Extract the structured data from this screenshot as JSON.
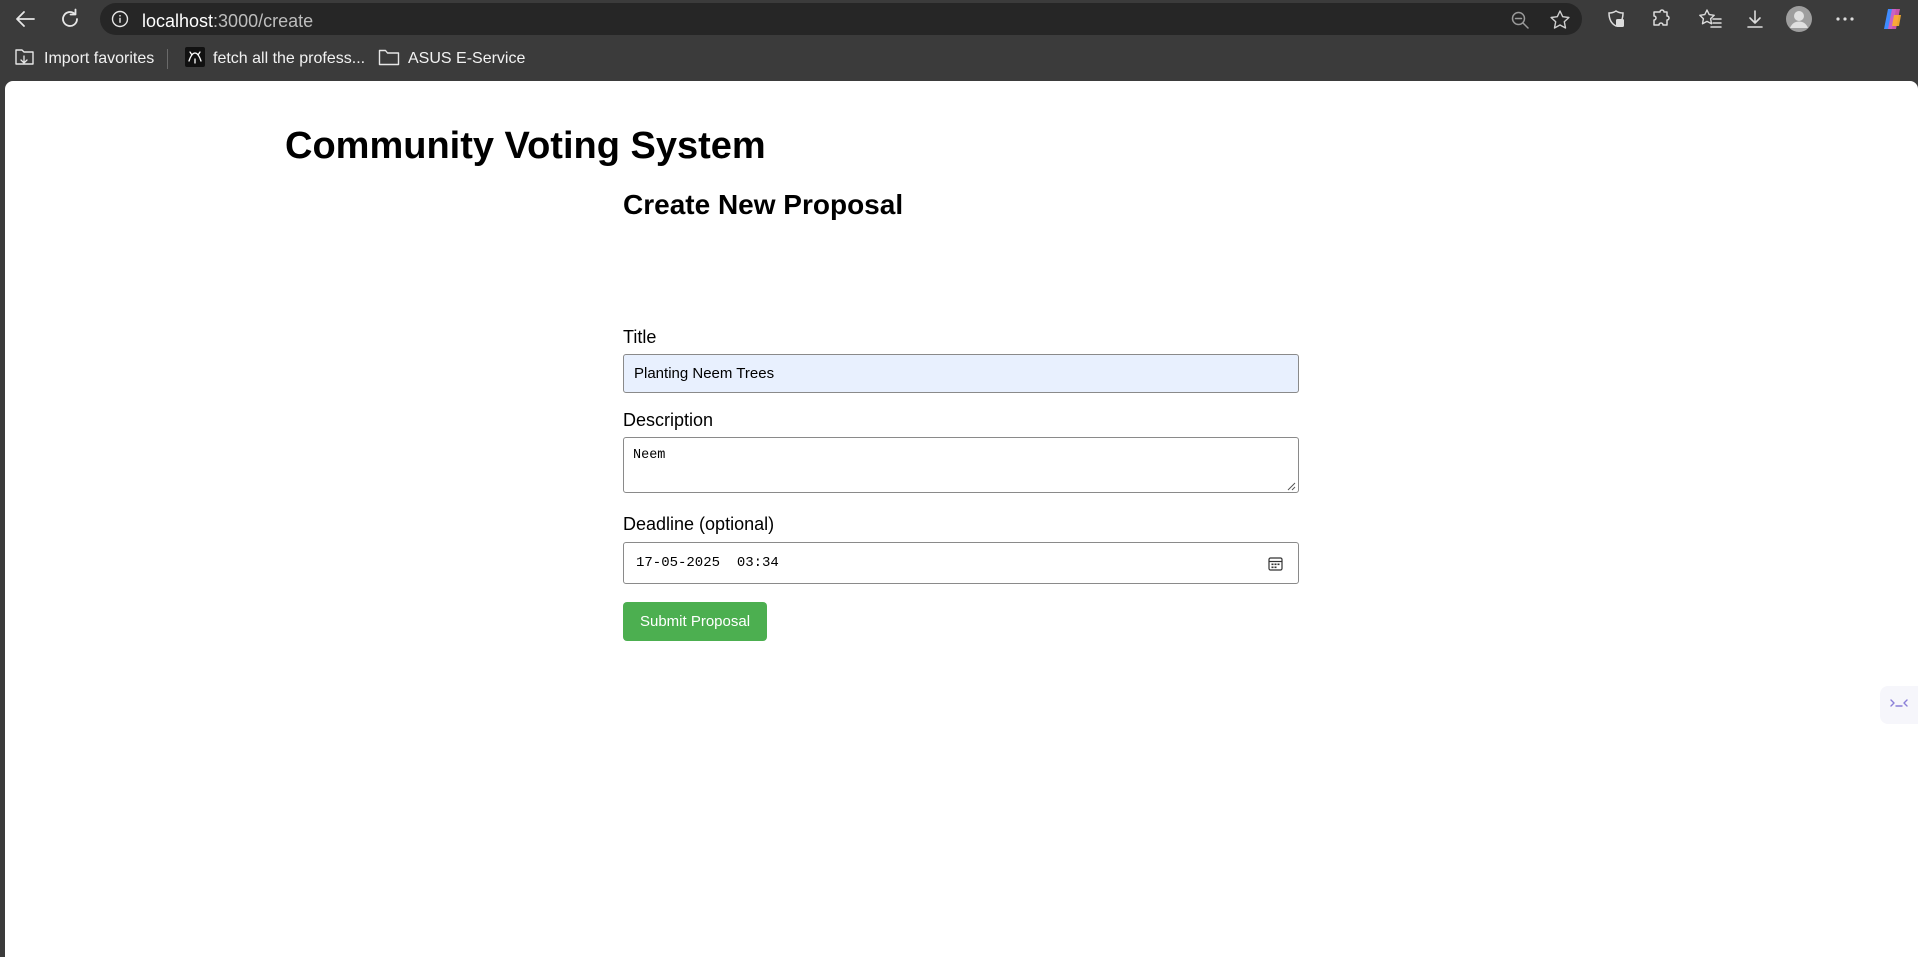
{
  "browser": {
    "url_host": "localhost",
    "url_path": ":3000/create",
    "icons": [
      "back-icon",
      "refresh-icon",
      "site-info-icon",
      "zoom-out-icon",
      "favorite-star-icon",
      "browser-essentials-icon",
      "extensions-icon",
      "favorites-icon",
      "downloads-icon",
      "profile-icon",
      "more-icon",
      "copilot-icon"
    ]
  },
  "favorites_bar": {
    "items": [
      {
        "label": "Import favorites",
        "icon": "import-icon"
      },
      {
        "label": "fetch all the profess...",
        "icon": "site-favicon"
      },
      {
        "label": "ASUS E-Service",
        "icon": "folder-icon"
      }
    ]
  },
  "page": {
    "app_title": "Community Voting System",
    "form_title": "Create New Proposal",
    "fields": {
      "title_label": "Title",
      "title_value": "Planting Neem Trees",
      "description_label": "Description",
      "description_value": "Neem",
      "deadline_label": "Deadline (optional)",
      "deadline_value": "17-05-2025  03:34"
    },
    "submit_label": "Submit Proposal"
  },
  "colors": {
    "submit_bg": "#4caf50",
    "autofill_bg": "#e8f0fe",
    "chrome_bg": "#3b3b3b"
  }
}
